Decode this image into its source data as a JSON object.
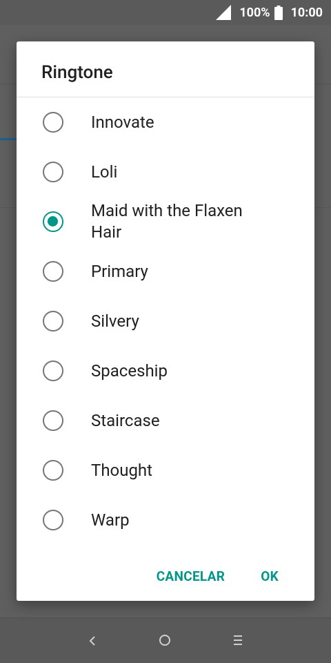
{
  "status_bar": {
    "battery": "100%",
    "time": "10:00"
  },
  "dialog": {
    "title": "Ringtone",
    "options": [
      {
        "label": "Innovate",
        "selected": false
      },
      {
        "label": "Loli",
        "selected": false
      },
      {
        "label": "Maid with the Flaxen Hair",
        "selected": true
      },
      {
        "label": "Primary",
        "selected": false
      },
      {
        "label": "Silvery",
        "selected": false
      },
      {
        "label": "Spaceship",
        "selected": false
      },
      {
        "label": "Staircase",
        "selected": false
      },
      {
        "label": "Thought",
        "selected": false
      },
      {
        "label": "Warp",
        "selected": false
      }
    ],
    "cancel_label": "CANCELAR",
    "ok_label": "OK"
  },
  "colors": {
    "accent": "#009688",
    "scrim": "#5f5f5f"
  },
  "icons": [
    "signal-icon",
    "battery-icon",
    "radio-icon",
    "back-icon",
    "home-icon",
    "recents-icon"
  ]
}
